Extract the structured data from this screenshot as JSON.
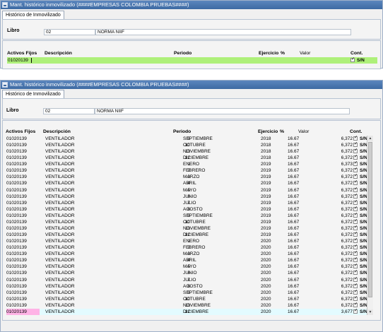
{
  "window1": {
    "title": "Mant. histórico inmovilizado (####EMPRESAS COLOMBIA PRUEBAS####)",
    "tab": "Histórico de Inmovilizado",
    "libro_label": "Libro",
    "libro_code": "02",
    "libro_name": "NORMA NIIF",
    "columns": {
      "activos": "Activos Fijos",
      "descripcion": "Descripción",
      "periodo": "Periodo",
      "ejercicio": "Ejercicio",
      "pct": "%",
      "valor": "Valor",
      "cont": "Cont."
    },
    "edit_row": {
      "activo": "01020139",
      "sn": "S/N"
    }
  },
  "window2": {
    "title": "Mant. histórico inmovilizado (####EMPRESAS COLOMBIA PRUEBAS####)",
    "tab": "Histórico de Inmovilizado",
    "libro_label": "Libro",
    "libro_code": "02",
    "libro_name": "NORMA NIIF",
    "columns": {
      "activos": "Activos Fijos",
      "descripcion": "Descripción",
      "periodo": "Periodo",
      "ejercicio": "Ejercicio",
      "pct": "%",
      "valor": "Valor",
      "cont": "Cont."
    },
    "rows": [
      {
        "activo": "01020139",
        "desc": "VENTILADOR",
        "num": "9",
        "mes": "SEPTIEMBRE",
        "ej": "2018",
        "pct": "16.67",
        "valor": "6,372",
        "sn": "S/N"
      },
      {
        "activo": "01020139",
        "desc": "VENTILADOR",
        "num": "10",
        "mes": "OCTUBRE",
        "ej": "2018",
        "pct": "16.67",
        "valor": "6,372",
        "sn": "S/N"
      },
      {
        "activo": "01020139",
        "desc": "VENTILADOR",
        "num": "11",
        "mes": "NOVIEMBRE",
        "ej": "2018",
        "pct": "16.67",
        "valor": "6,372",
        "sn": "S/N"
      },
      {
        "activo": "01020139",
        "desc": "VENTILADOR",
        "num": "12",
        "mes": "DICIEMBRE",
        "ej": "2018",
        "pct": "16.67",
        "valor": "6,372",
        "sn": "S/N"
      },
      {
        "activo": "01020139",
        "desc": "VENTILADOR",
        "num": "1",
        "mes": "ENERO",
        "ej": "2019",
        "pct": "16.67",
        "valor": "6,373",
        "sn": "S/N"
      },
      {
        "activo": "01020139",
        "desc": "VENTILADOR",
        "num": "2",
        "mes": "FEBRERO",
        "ej": "2019",
        "pct": "16.67",
        "valor": "6,372",
        "sn": "S/N"
      },
      {
        "activo": "01020139",
        "desc": "VENTILADOR",
        "num": "3",
        "mes": "MARZO",
        "ej": "2019",
        "pct": "16.67",
        "valor": "6,372",
        "sn": "S/N"
      },
      {
        "activo": "01020139",
        "desc": "VENTILADOR",
        "num": "4",
        "mes": "ABRIL",
        "ej": "2019",
        "pct": "16.67",
        "valor": "6,372",
        "sn": "S/N"
      },
      {
        "activo": "01020139",
        "desc": "VENTILADOR",
        "num": "5",
        "mes": "MAYO",
        "ej": "2019",
        "pct": "16.67",
        "valor": "6,372",
        "sn": "S/N"
      },
      {
        "activo": "01020139",
        "desc": "VENTILADOR",
        "num": "6",
        "mes": "JUNIO",
        "ej": "2019",
        "pct": "16.67",
        "valor": "6,372",
        "sn": "S/N"
      },
      {
        "activo": "01020139",
        "desc": "VENTILADOR",
        "num": "7",
        "mes": "JULIO",
        "ej": "2019",
        "pct": "16.67",
        "valor": "6,372",
        "sn": "S/N"
      },
      {
        "activo": "01020139",
        "desc": "VENTILADOR",
        "num": "8",
        "mes": "AGOSTO",
        "ej": "2019",
        "pct": "16.67",
        "valor": "6,372",
        "sn": "S/N"
      },
      {
        "activo": "01020139",
        "desc": "VENTILADOR",
        "num": "9",
        "mes": "SEPTIEMBRE",
        "ej": "2019",
        "pct": "16.67",
        "valor": "6,372",
        "sn": "S/N"
      },
      {
        "activo": "01020139",
        "desc": "VENTILADOR",
        "num": "10",
        "mes": "OCTUBRE",
        "ej": "2019",
        "pct": "16.67",
        "valor": "6,372",
        "sn": "S/N"
      },
      {
        "activo": "01020139",
        "desc": "VENTILADOR",
        "num": "11",
        "mes": "NOVIEMBRE",
        "ej": "2019",
        "pct": "16.67",
        "valor": "6,372",
        "sn": "S/N"
      },
      {
        "activo": "01020139",
        "desc": "VENTILADOR",
        "num": "12",
        "mes": "DICIEMBRE",
        "ej": "2019",
        "pct": "16.67",
        "valor": "6,372",
        "sn": "S/N"
      },
      {
        "activo": "01020139",
        "desc": "VENTILADOR",
        "num": "1",
        "mes": "ENERO",
        "ej": "2020",
        "pct": "16.67",
        "valor": "6,372",
        "sn": "S/N"
      },
      {
        "activo": "01020139",
        "desc": "VENTILADOR",
        "num": "2",
        "mes": "FEBRERO",
        "ej": "2020",
        "pct": "16.67",
        "valor": "6,372",
        "sn": "S/N"
      },
      {
        "activo": "01020139",
        "desc": "VENTILADOR",
        "num": "3",
        "mes": "MARZO",
        "ej": "2020",
        "pct": "16.67",
        "valor": "6,372",
        "sn": "S/N"
      },
      {
        "activo": "01020139",
        "desc": "VENTILADOR",
        "num": "4",
        "mes": "ABRIL",
        "ej": "2020",
        "pct": "16.67",
        "valor": "6,372",
        "sn": "S/N"
      },
      {
        "activo": "01020139",
        "desc": "VENTILADOR",
        "num": "5",
        "mes": "MAYO",
        "ej": "2020",
        "pct": "16.67",
        "valor": "6,372",
        "sn": "S/N"
      },
      {
        "activo": "01020139",
        "desc": "VENTILADOR",
        "num": "6",
        "mes": "JUNIO",
        "ej": "2020",
        "pct": "16.67",
        "valor": "6,372",
        "sn": "S/N"
      },
      {
        "activo": "01020139",
        "desc": "VENTILADOR",
        "num": "7",
        "mes": "JULIO",
        "ej": "2020",
        "pct": "16.67",
        "valor": "6,372",
        "sn": "S/N"
      },
      {
        "activo": "01020139",
        "desc": "VENTILADOR",
        "num": "8",
        "mes": "AGOSTO",
        "ej": "2020",
        "pct": "16.67",
        "valor": "6,372",
        "sn": "S/N"
      },
      {
        "activo": "01020139",
        "desc": "VENTILADOR",
        "num": "9",
        "mes": "SEPTIEMBRE",
        "ej": "2020",
        "pct": "16.67",
        "valor": "6,372",
        "sn": "S/N"
      },
      {
        "activo": "01020139",
        "desc": "VENTILADOR",
        "num": "10",
        "mes": "OCTUBRE",
        "ej": "2020",
        "pct": "16.67",
        "valor": "6,372",
        "sn": "S/N"
      },
      {
        "activo": "01020139",
        "desc": "VENTILADOR",
        "num": "11",
        "mes": "NOVIEMBRE",
        "ej": "2020",
        "pct": "16.67",
        "valor": "6,372",
        "sn": "S/N"
      },
      {
        "activo": "01020139",
        "desc": "VENTILADOR",
        "num": "12",
        "mes": "DICIEMBRE",
        "ej": "2020",
        "pct": "16.67",
        "valor": "3,677",
        "sn": "S/N"
      }
    ]
  },
  "colors": {
    "edit_row": "#aef07a",
    "selected_row": "#e3fbff",
    "selected_cell": "#ffb3e6",
    "titlebar": "#4a76ae"
  }
}
